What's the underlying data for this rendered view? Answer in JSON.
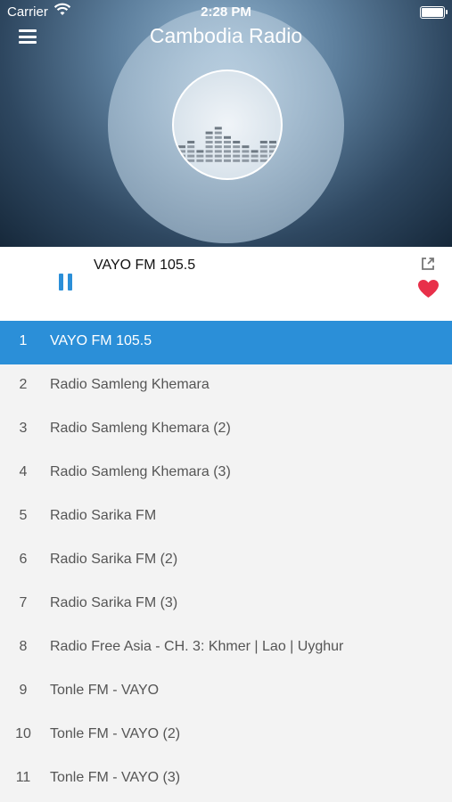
{
  "status_bar": {
    "carrier": "Carrier",
    "time": "2:28 PM"
  },
  "header": {
    "title": "Cambodia Radio"
  },
  "player": {
    "now_playing": "VAYO FM 105.5",
    "state": "playing"
  },
  "colors": {
    "accent": "#2b8fd8",
    "favorite": "#e8304a"
  },
  "stations": [
    {
      "num": "1",
      "name": "VAYO FM 105.5",
      "selected": true
    },
    {
      "num": "2",
      "name": "Radio Samleng Khemara"
    },
    {
      "num": "3",
      "name": "Radio Samleng Khemara (2)"
    },
    {
      "num": "4",
      "name": "Radio Samleng Khemara (3)"
    },
    {
      "num": "5",
      "name": "Radio Sarika FM"
    },
    {
      "num": "6",
      "name": "Radio Sarika FM (2)"
    },
    {
      "num": "7",
      "name": "Radio Sarika FM (3)"
    },
    {
      "num": "8",
      "name": "Radio Free Asia - CH. 3: Khmer | Lao | Uyghur"
    },
    {
      "num": "9",
      "name": "Tonle FM - VAYO"
    },
    {
      "num": "10",
      "name": "Tonle FM - VAYO (2)"
    },
    {
      "num": "11",
      "name": "Tonle FM - VAYO (3)"
    }
  ],
  "icons": {
    "menu": "hamburger-menu-icon",
    "wifi": "wifi-icon",
    "battery": "battery-icon",
    "pause": "pause-icon",
    "share": "share-icon",
    "favorite": "heart-icon",
    "equalizer": "equalizer-icon"
  }
}
